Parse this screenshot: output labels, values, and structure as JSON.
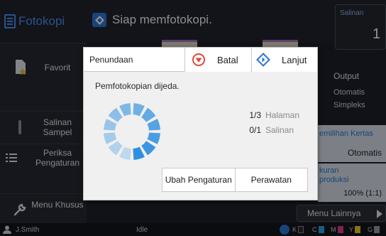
{
  "app": {
    "title": "Fotokopi",
    "status": "Siap memfotokopi.",
    "copies_label": "Salinan",
    "copies_value": "1"
  },
  "sidebar": {
    "items": [
      {
        "label": "Favorit"
      },
      {
        "label": "Salinan Sampel"
      },
      {
        "label": "Periksa Pengaturan"
      },
      {
        "label": "Menu Khusus"
      }
    ]
  },
  "right_panel": {
    "output_label": "Output",
    "output_value_1": "Otomatis",
    "output_value_2": "Simpleks",
    "paper_label": "emilihan Kertas",
    "paper_value": "Otomatis",
    "scale_label": "kuran produksi",
    "scale_value": "100% (1:1)",
    "more_menu": "Menu Lainnya"
  },
  "statusbar": {
    "user": "J.Smith",
    "state": "Idle",
    "ink": [
      {
        "label": "K",
        "color": "#2a2a2a"
      },
      {
        "label": "C",
        "color": "#2aa0e0"
      },
      {
        "label": "M",
        "color": "#d83c8a"
      },
      {
        "label": "Y",
        "color": "#e8c82a"
      },
      {
        "label": "G",
        "color": "#9a9a9a"
      }
    ]
  },
  "dialog": {
    "title": "Penundaan",
    "cancel_label": "Batal",
    "continue_label": "Lanjut",
    "message": "Pemfotokopian dijeda.",
    "pages_progress": "1/3",
    "pages_unit": "Halaman",
    "copies_progress": "0/1",
    "copies_unit": "Salinan",
    "change_settings_label": "Ubah Pengaturan",
    "maintenance_label": "Perawatan"
  },
  "colors": {
    "accent": "#2a76d2",
    "stop": "#e0483c",
    "spinner": "#2f8fe0"
  }
}
